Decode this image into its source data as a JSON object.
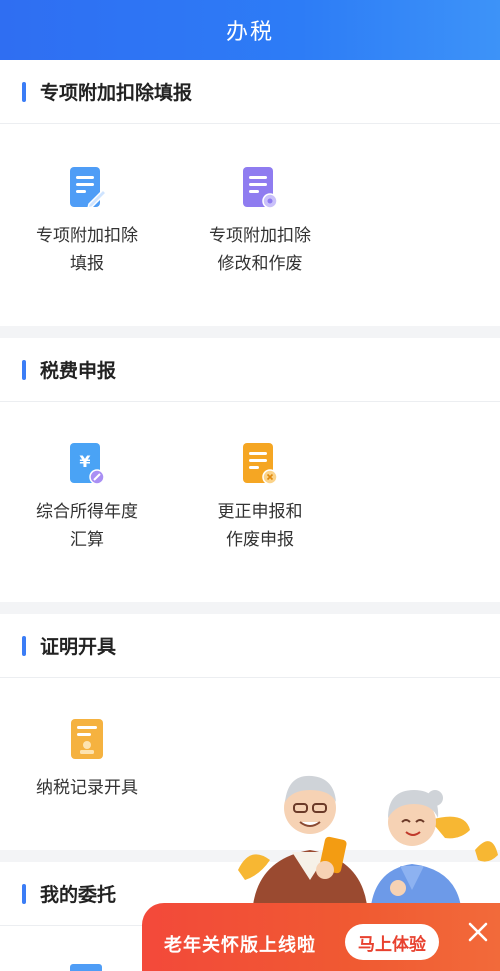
{
  "header": {
    "title": "办税"
  },
  "sections": [
    {
      "title": "专项附加扣除填报",
      "tiles": [
        {
          "label": "专项附加扣除\n填报",
          "icon": "form-edit-icon"
        },
        {
          "label": "专项附加扣除\n修改和作废",
          "icon": "form-settings-icon"
        }
      ]
    },
    {
      "title": "税费申报",
      "tiles": [
        {
          "label": "综合所得年度\n汇算",
          "icon": "yuan-doc-icon"
        },
        {
          "label": "更正申报和\n作废申报",
          "icon": "doc-cancel-icon"
        }
      ]
    },
    {
      "title": "证明开具",
      "tiles": [
        {
          "label": "纳税记录开具",
          "icon": "certificate-icon"
        }
      ]
    },
    {
      "title": "我的委托",
      "tiles": []
    }
  ],
  "banner": {
    "text": "老年关怀版上线啦",
    "button": "马上体验"
  },
  "colors": {
    "header": "#2f6ef2",
    "accent_bar": "#3b7df6",
    "banner": "#f3493a"
  }
}
